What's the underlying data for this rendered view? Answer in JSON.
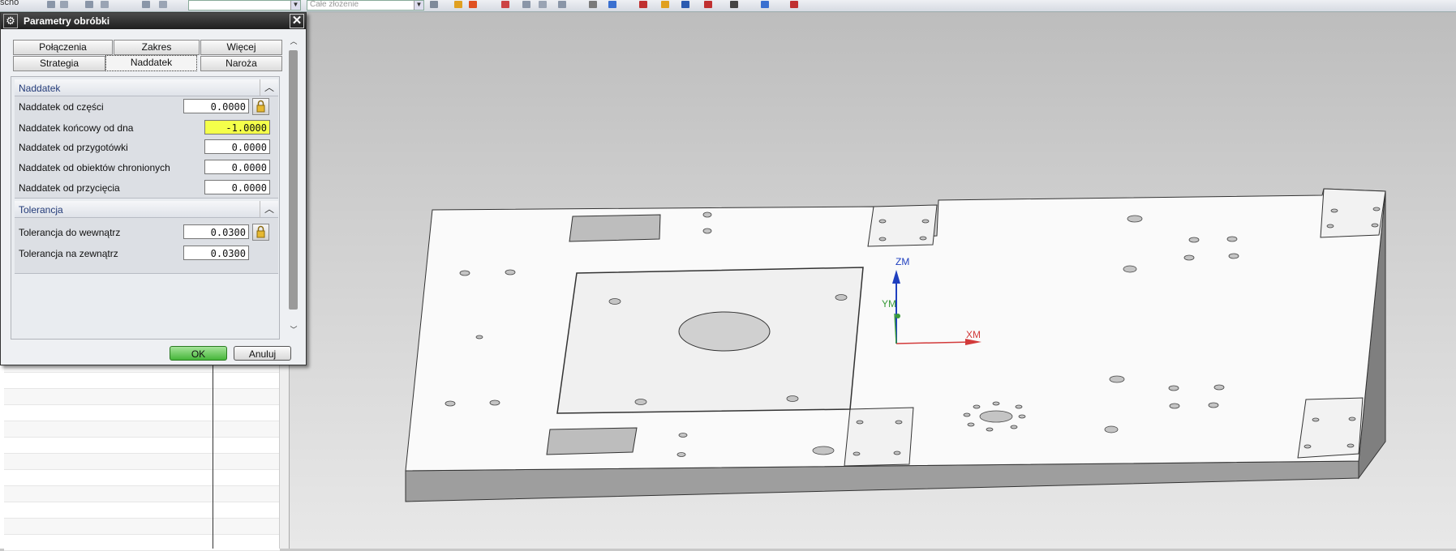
{
  "toolbar": {
    "left_text": "ścho",
    "combo1_value": "",
    "combo2_value": "Całe złożenie"
  },
  "dialog": {
    "title": "Parametry obróbki",
    "close_glyph": "✕",
    "tabs_row1": [
      "Połączenia",
      "Zakres",
      "Więcej"
    ],
    "tabs_row2": [
      "Strategia",
      "Naddatek",
      "Naroża"
    ],
    "active_tab": "Naddatek",
    "groups": {
      "naddatek": {
        "label": "Naddatek",
        "fields": [
          {
            "label": "Naddatek od części",
            "value": "0.0000",
            "locked": true
          },
          {
            "label": "Naddatek końcowy od dna",
            "value": "-1.0000",
            "highlighted": true
          },
          {
            "label": "Naddatek od przygotówki",
            "value": "0.0000"
          },
          {
            "label": "Naddatek od obiektów chronionych",
            "value": "0.0000"
          },
          {
            "label": "Naddatek od przycięcia",
            "value": "0.0000"
          }
        ]
      },
      "tolerancja": {
        "label": "Tolerancja",
        "fields": [
          {
            "label": "Tolerancja do wewnątrz",
            "value": "0.0300",
            "locked": true
          },
          {
            "label": "Tolerancja na zewnątrz",
            "value": "0.0300"
          }
        ]
      }
    },
    "ok_label": "OK",
    "cancel_label": "Anuluj"
  },
  "viewport": {
    "axes": {
      "z": "ZM",
      "y": "YM",
      "x": "XM"
    },
    "axis_colors": {
      "z": "#1f3fbf",
      "y": "#3a9a3a",
      "x": "#d23a3a"
    },
    "highlight_color": "#dce600",
    "ok_color": "#46b63a"
  }
}
